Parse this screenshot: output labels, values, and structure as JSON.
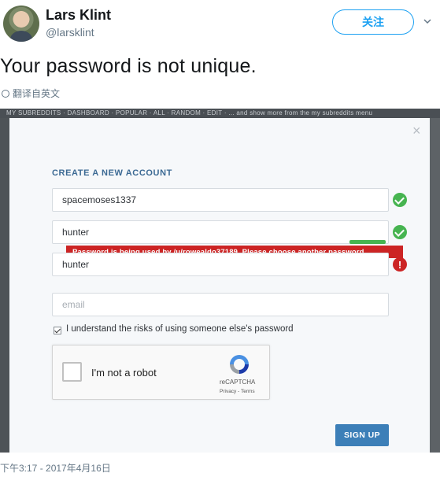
{
  "tweet": {
    "author": {
      "name": "Lars Klint",
      "handle": "@larsklint"
    },
    "follow_label": "关注",
    "text": "Your password is not unique.",
    "translate_label": "翻译自英文",
    "timestamp": "下午3:17 - 2017年4月16日"
  },
  "screenshot": {
    "topbar_text": "MY SUBREDDITS · DASHBOARD · POPULAR · ALL · RANDOM · EDIT · ... and show more from the my subreddits menu",
    "close_label": "×",
    "form_title": "CREATE A NEW ACCOUNT",
    "username_value": "spacemoses1337",
    "password_value": "hunter",
    "password_error": "Password is being used by /u/rowealdo37189. Please choose another password.",
    "verify_value": "hunter",
    "email_placeholder": "email",
    "terms_label": "I understand the risks of using someone else's password",
    "terms_checked": true,
    "captcha": {
      "label": "I'm not a robot",
      "brand": "reCAPTCHA",
      "links": "Privacy - Terms"
    },
    "signup_label": "SIGN UP"
  },
  "colors": {
    "accent": "#1da1f2",
    "error": "#cc2424",
    "success": "#46b450",
    "button": "#3c7fb8"
  }
}
